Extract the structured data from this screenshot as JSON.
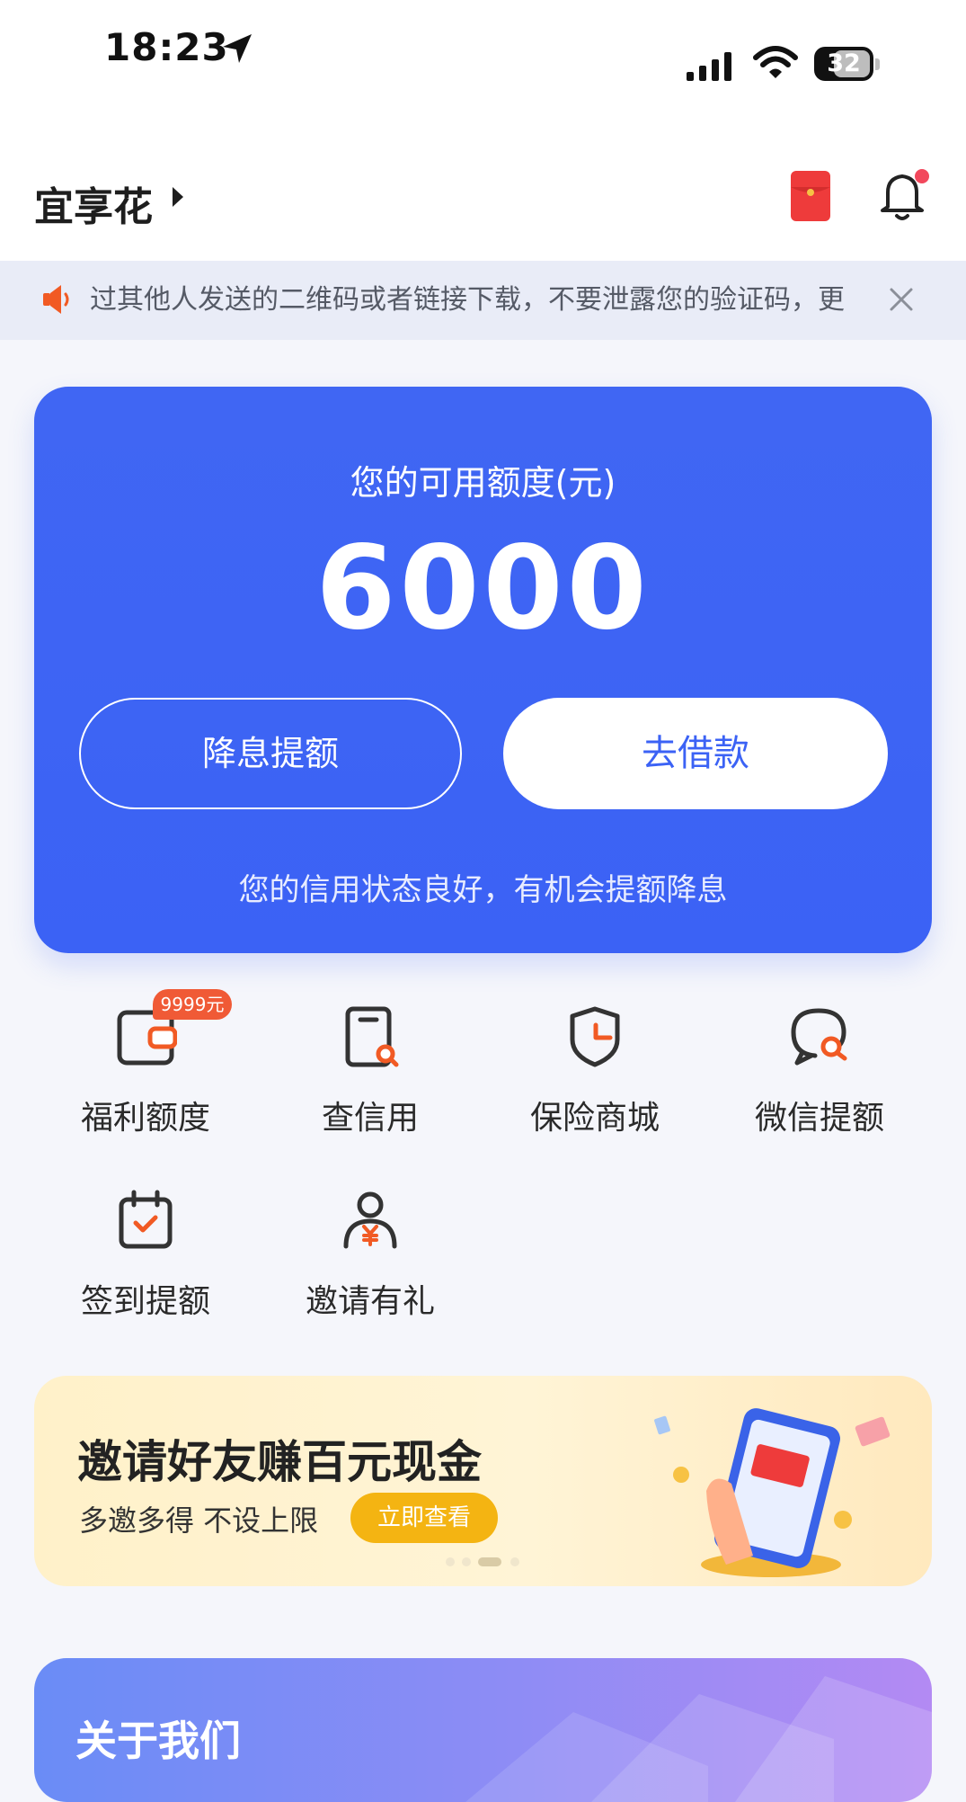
{
  "status_bar": {
    "time": "18:23",
    "battery": "32",
    "icons": [
      "location-arrow-icon",
      "cellular-signal-icon",
      "wifi-icon",
      "battery-icon"
    ]
  },
  "header": {
    "title": "宜享花",
    "icons": [
      "caret-right-icon",
      "red-packet-icon",
      "bell-icon"
    ],
    "has_notification_dot": true
  },
  "notice": {
    "text": "过其他人发送的二维码或者链接下载，不要泄露您的验证码，更",
    "icons": [
      "speaker-icon",
      "close-icon"
    ]
  },
  "credit_card": {
    "label": "您的可用额度(元)",
    "amount": "6000",
    "button_reduce": "降息提额",
    "button_borrow": "去借款",
    "tip": "您的信用状态良好，有机会提额降息"
  },
  "services": [
    {
      "label": "福利额度",
      "icon": "wallet-icon",
      "badge": "9999元"
    },
    {
      "label": "查信用",
      "icon": "credit-search-icon"
    },
    {
      "label": "保险商城",
      "icon": "shield-icon"
    },
    {
      "label": "微信提额",
      "icon": "chat-search-icon"
    },
    {
      "label": "签到提额",
      "icon": "calendar-check-icon"
    },
    {
      "label": "邀请有礼",
      "icon": "user-yuan-icon"
    }
  ],
  "banner": {
    "title": "邀请好友赚百元现金",
    "subtitle": "多邀多得 不设上限",
    "button": "立即查看",
    "page_count": 4,
    "active_page": 3
  },
  "about": {
    "title": "关于我们"
  },
  "colors": {
    "primary": "#3b62f5",
    "badge": "#f05a36",
    "banner_button": "#f4b412",
    "accent_orange": "#f15a24"
  }
}
